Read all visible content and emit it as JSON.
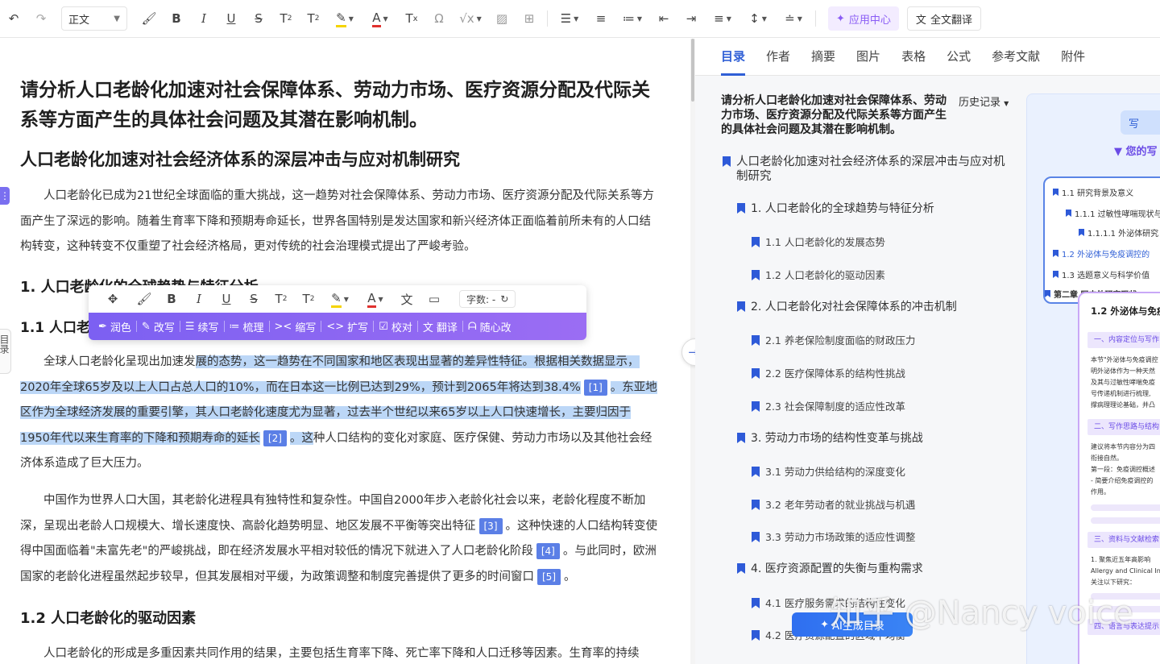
{
  "toolbar": {
    "style_select": "正文",
    "app_center": "应用中心",
    "translate": "全文翻译"
  },
  "doc": {
    "title": "请分析人口老龄化加速对社会保障体系、劳动力市场、医疗资源分配及代际关系等方面产生的具体社会问题及其潜在影响机制。",
    "h1": "人口老龄化加速对社会经济体系的深层冲击与应对机制研究",
    "intro": "人口老龄化已成为21世纪全球面临的重大挑战，这一趋势对社会保障体系、劳动力市场、医疗资源分配及代际关系等方面产生了深远的影响。随着生育率下降和预期寿命延长，世界各国特别是发达国家和新兴经济体正面临着前所未有的人口结构转变，这种转变不仅重塑了社会经济格局，更对传统的社会治理模式提出了严峻考验。",
    "h2_1": "1. 人口老龄化的全球趋势与特征分析",
    "h3_1_prefix": "1.1 人口老",
    "p2_a": "全球人口老龄化呈现出加速发",
    "p2_b": "展的态势，这一趋势在不同国家和地区表现出显著的差异性特征。根据相关数据显示，2020年全球65岁及以上人口占总人口的10%，而在日本这一比例已达到29%，预计到2065年将达到38.4%",
    "cite1": "[1]",
    "p2_c": "。东亚地区作为全球经济发展的重要引擎，其人口老龄化速度尤为显著，过去半个世纪以来65岁以上人口快速增长，主要归因于1950年代以来生育率的下降和预期寿命的延长",
    "cite2": "[2]",
    "p2_d": "。这",
    "p2_e": "种人口结构的变化对家庭、医疗保健、劳动力市场以及其他社会经济体系造成了巨大压力。",
    "p3_a": "中国作为世界人口大国，其老龄化进程具有独特性和复杂性。中国自2000年步入老龄化社会以来，老龄化程度不断加深，呈现出老龄人口规模大、增长速度快、高龄化趋势明显、地区发展不平衡等突出特征",
    "cite3": "[3]",
    "p3_b": "。这种快速的人口结构转变使得中国面临着\"未富先老\"的严峻挑战，即在经济发展水平相对较低的情况下就进入了人口老龄化阶段",
    "cite4": "[4]",
    "p3_c": "。与此同时，欧洲国家的老龄化进程虽然起步较早，但其发展相对平缓，为政策调整和制度完善提供了更多的时间窗口",
    "cite5": "[5]",
    "p3_d": "。",
    "h3_2": "1.2 人口老龄化的驱动因素",
    "p4": "人口老龄化的形成是多重因素共同作用的结果，主要包括生育率下降、死亡率下降和人口迁移等因素。生育率的持续"
  },
  "side": {
    "dot": "⋮",
    "toc_tab": "目录"
  },
  "float_bar": {
    "word_count_label": "字数: -",
    "ai_items": [
      "润色",
      "改写",
      "续写",
      "梳理",
      "缩写",
      "扩写",
      "校对",
      "翻译",
      "随心改"
    ]
  },
  "panel": {
    "tabs": [
      "目录",
      "作者",
      "摘要",
      "图片",
      "表格",
      "公式",
      "参考文献",
      "附件"
    ],
    "toc_title": "请分析人口老龄化加速对社会保障体系、劳动力市场、医疗资源分配及代际关系等方面产生的具体社会问题及其潜在影响机制。",
    "history": "历史记录",
    "toc": [
      {
        "level": 0,
        "text": "人口老龄化加速对社会经济体系的深层冲击与应对机制研究"
      },
      {
        "level": 1,
        "text": "1. 人口老龄化的全球趋势与特征分析"
      },
      {
        "level": 2,
        "text": "1.1 人口老龄化的发展态势"
      },
      {
        "level": 2,
        "text": "1.2 人口老龄化的驱动因素"
      },
      {
        "level": 1,
        "text": "2. 人口老龄化对社会保障体系的冲击机制"
      },
      {
        "level": 2,
        "text": "2.1 养老保险制度面临的财政压力"
      },
      {
        "level": 2,
        "text": "2.2 医疗保障体系的结构性挑战"
      },
      {
        "level": 2,
        "text": "2.3 社会保障制度的适应性改革"
      },
      {
        "level": 1,
        "text": "3. 劳动力市场的结构性变革与挑战"
      },
      {
        "level": 2,
        "text": "3.1 劳动力供给结构的深度变化"
      },
      {
        "level": 2,
        "text": "3.2 老年劳动者的就业挑战与机遇"
      },
      {
        "level": 2,
        "text": "3.3 劳动力市场政策的适应性调整"
      },
      {
        "level": 1,
        "text": "4. 医疗资源配置的失衡与重构需求"
      },
      {
        "level": 2,
        "text": "4.1 医疗服务需求的结构性变化"
      },
      {
        "level": 2,
        "text": "4.2 医疗资源配置的区域不均衡"
      }
    ],
    "ai_toc_btn": "AI生成目录"
  },
  "preview": {
    "badge": "写",
    "heading": "▼ 您的写",
    "toc_items": [
      {
        "text": "1.1 研究背景及意义",
        "blue": false
      },
      {
        "text": "1.1.1 过敏性哮喘现状与",
        "blue": false
      },
      {
        "text": "1.1.1.1 外泌体研究",
        "blue": false
      },
      {
        "text": "1.2 外泌体与免疫调控的",
        "blue": true
      },
      {
        "text": "1.3 选题意义与科学价值",
        "blue": false
      },
      {
        "text": "第二章 国内外研究现状",
        "blue": false
      }
    ],
    "doc_title": "1.2 外泌体与免疫",
    "sec1": "一、内容定位与写作目",
    "sec1_text": [
      "本节\"外泌体与免疫调控",
      "明外泌体作为一种天然",
      "及其与过敏性哮喘免疫",
      "号传递机制进行梳理,",
      "撑病理理论基础，并凸"
    ],
    "sec2": "二、写作思路与结构",
    "sec2_text": [
      "建议将本节内容分为四",
      "衔接自然。",
      "第一段：免疫调控概述",
      "- 简要介绍免疫调控的",
      "作用。"
    ],
    "sec3": "三、资料与文献检索",
    "sec3_text": [
      "1. 聚焦近五年高影响",
      "Allergy and Clinical In",
      "关注以下研究："
    ],
    "sec4": "四、语言与表达提示"
  },
  "watermark": "知乎 @Nancy voice"
}
